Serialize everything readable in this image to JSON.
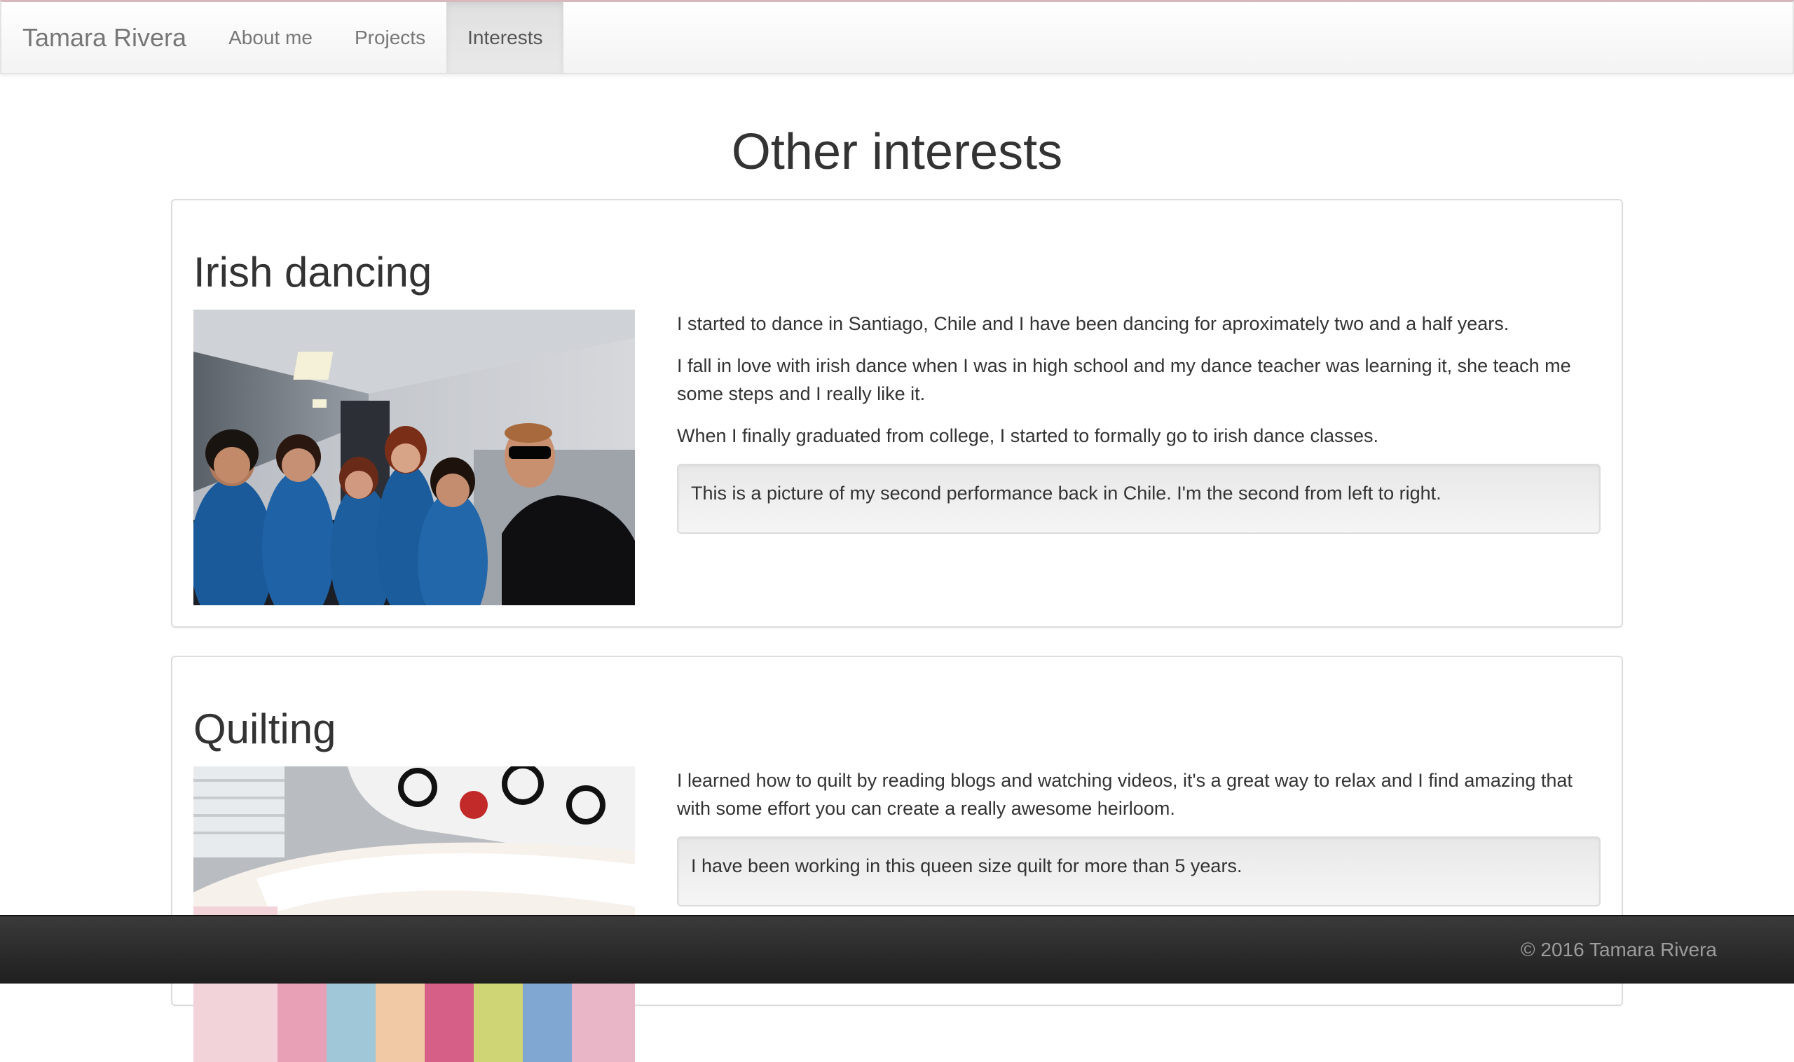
{
  "navbar": {
    "brand": "Tamara Rivera",
    "items": [
      {
        "label": "About me",
        "active": false
      },
      {
        "label": "Projects",
        "active": false
      },
      {
        "label": "Interests",
        "active": true
      }
    ]
  },
  "main": {
    "title": "Other interests",
    "sections": [
      {
        "heading": "Irish dancing",
        "image_alt": "Irish dance group photo",
        "paragraphs": [
          "I started to dance in Santiago, Chile and I have been dancing for aproximately two and a half years.",
          "I fall in love with irish dance when I was in high school and my dance teacher was learning it, she teach me some steps and I really like it.",
          "When I finally graduated from college, I started to formally go to irish dance classes."
        ],
        "note": "This is a picture of my second performance back in Chile. I'm the second from left to right."
      },
      {
        "heading": "Quilting",
        "image_alt": "Patchwork quilt photo",
        "paragraphs": [
          "I learned how to quilt by reading blogs and watching videos, it's a great way to relax and I find amazing that with some effort you can create a really awesome heirloom."
        ],
        "note": "I have been working in this queen size quilt for more than 5 years."
      }
    ]
  },
  "footer": {
    "text": "© 2016 Tamara Rivera"
  },
  "colors": {
    "navbar_bg": "#f8f8f8",
    "nav_text": "#777777",
    "active_bg": "#e7e7e7",
    "footer_bg": "#222222",
    "footer_text": "#9d9d9d",
    "body_text": "#333333"
  }
}
